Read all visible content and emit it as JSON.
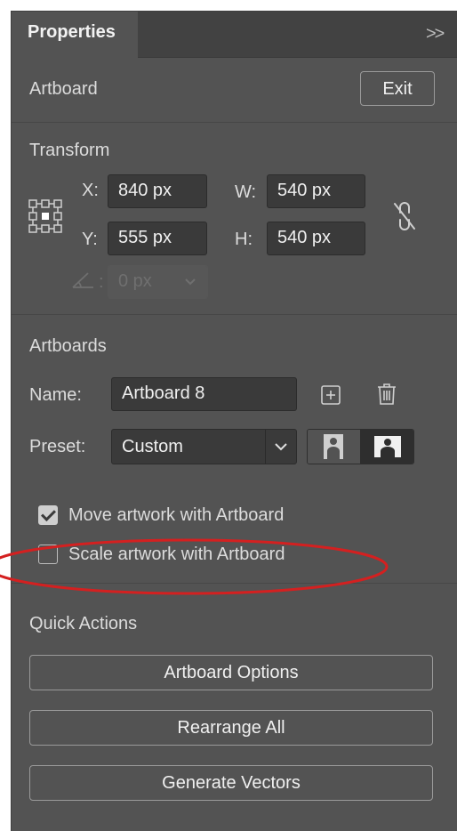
{
  "tabs": {
    "properties": "Properties",
    "collapse": ">>"
  },
  "artboard": {
    "title": "Artboard",
    "exit_label": "Exit"
  },
  "transform": {
    "heading": "Transform",
    "x_label": "X:",
    "x_value": "840 px",
    "y_label": "Y:",
    "y_value": "555 px",
    "w_label": "W:",
    "w_value": "540 px",
    "h_label": "H:",
    "h_value": "540 px",
    "angle_label": ":",
    "angle_value": "0 px"
  },
  "artboards": {
    "heading": "Artboards",
    "name_label": "Name:",
    "name_value": "Artboard 8",
    "preset_label": "Preset:",
    "preset_value": "Custom",
    "move_artwork_label": "Move artwork with Artboard",
    "move_artwork_checked": true,
    "scale_artwork_label": "Scale artwork with Artboard",
    "scale_artwork_checked": false
  },
  "quick_actions": {
    "heading": "Quick Actions",
    "buttons": [
      "Artboard Options",
      "Rearrange All",
      "Generate Vectors"
    ]
  },
  "colors": {
    "panel_bg": "#535353",
    "field_bg": "#3a3a3a",
    "annotation": "#d42020"
  }
}
